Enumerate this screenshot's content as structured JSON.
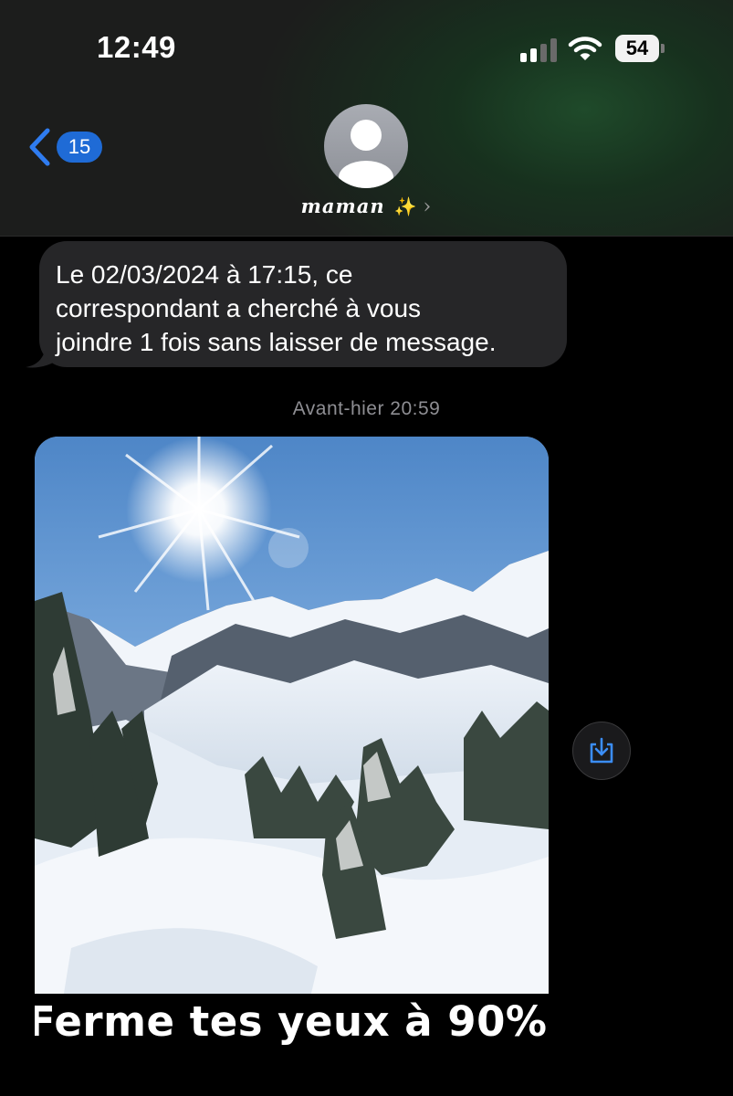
{
  "status_bar": {
    "time": "12:49",
    "battery": "54",
    "icons": [
      "signal-icon",
      "wifi-icon",
      "battery-icon"
    ]
  },
  "header": {
    "back_count": "15",
    "contact_name": "maman",
    "contact_emoji": "✨",
    "contact_chevron": "›"
  },
  "messages": {
    "missed_call_text": "Le 02/03/2024 à 17:15, ce\ncorrespondant a cherché à vous\njoindre 1 fois sans laisser de message.",
    "timestamp": "Avant-hier 20:59",
    "image_caption": "Ferme tes yeux à 90%"
  },
  "colors": {
    "accent": "#1f6bd6",
    "bubble": "#262628",
    "timestamp": "#8e8e93"
  }
}
